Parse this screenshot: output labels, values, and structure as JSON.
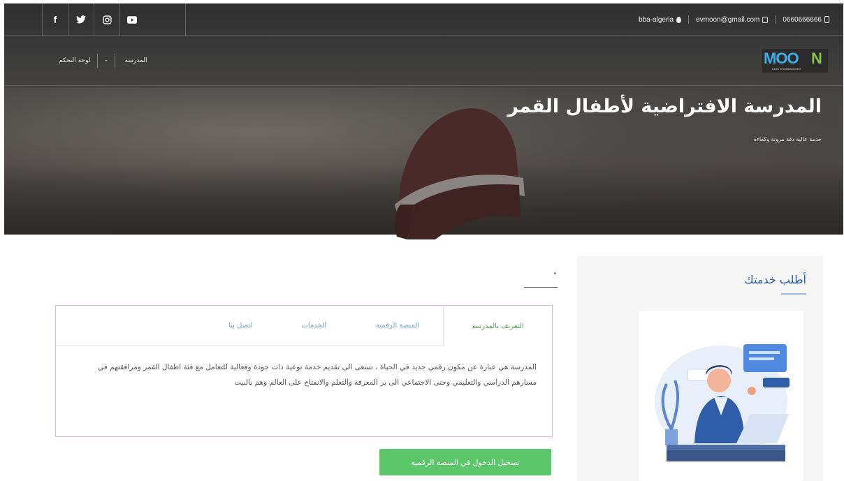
{
  "topbar": {
    "socials": [
      "f",
      "t",
      "o",
      "▶"
    ],
    "location": "bba-algeria",
    "email": "evmoon@gmail.com",
    "phone": "0660666666"
  },
  "nav": {
    "items": [
      "لوحة التحكم",
      "-",
      "المدرسة"
    ],
    "logo_text": {
      "m": "MOO",
      "n": "N",
      "sub": "Learn at a distant place"
    }
  },
  "hero": {
    "title": "المدرسة الافتراضية لأطفال القمر",
    "subtitle": "خدمة عالية دقة مرونة وكفاءة"
  },
  "sidebar": {
    "title": "أطلب خدمتك"
  },
  "tabs": {
    "items": [
      "التعريف بالمدرسة",
      "المنصة الرقمية",
      "الخدمات",
      "اتصل بنا"
    ],
    "active_index": 0,
    "content": "المدرسة هي عبارة عن مكون رقمي جديد في الحياة ، تسعى الى تقديم خدمة نوعية ذات جودة وفعالية للتعامل مع فئة اطفال القمر ومرافقتهم في مسارهم الدراسي والتعليمي وحتى الاجتماعي الى بر المعرفة والتعلم والانفتاح على العالم وهم بالبيت"
  },
  "cta": {
    "label": "تسجيل الدخول في المنصة الرقمية"
  },
  "colors": {
    "accent_green": "#5cc66a",
    "tab_blue": "#6aa6d6",
    "tab_active_green": "#5aa75a",
    "title_blue": "#2b5fa8",
    "tab_border": "#e5b7e8"
  }
}
